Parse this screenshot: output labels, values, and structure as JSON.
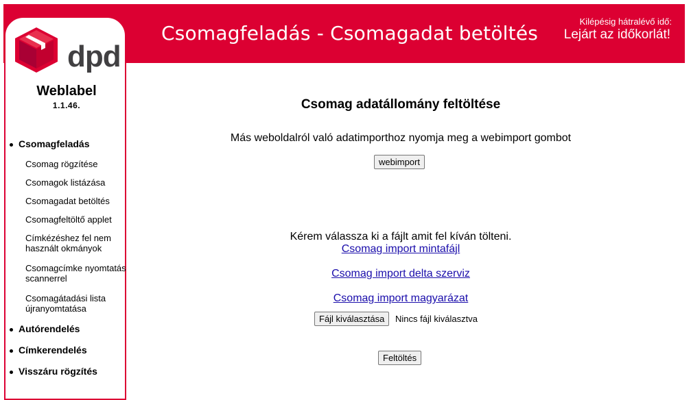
{
  "header": {
    "title": "Csomagfeladás - Csomagadat betöltés",
    "session_label": "Kilépésig hátralévő idő:",
    "session_value": "Lejárt az időkorlát!",
    "accent_color": "#dc0032"
  },
  "sidebar": {
    "logo_text": "dpd",
    "logo_icon": "dpd-cube-icon",
    "app_name": "Weblabel",
    "app_version": "1.1.46.",
    "main_items": [
      {
        "label": "Csomagfeladás"
      },
      {
        "label": "Autórendelés"
      },
      {
        "label": "Címkerendelés"
      },
      {
        "label": "Visszáru rögzítés"
      }
    ],
    "sub_items": [
      {
        "label": "Csomag rögzítése"
      },
      {
        "label": "Csomagok listázása"
      },
      {
        "label": "Csomagadat betöltés"
      },
      {
        "label": "Csomagfeltöltő applet"
      },
      {
        "label": "Címkézéshez fel nem használt okmányok"
      },
      {
        "label": "Csomagcímke nyomtatás scannerrel"
      },
      {
        "label": "Csomagátadási lista újranyomtatása"
      }
    ]
  },
  "main": {
    "heading": "Csomag adatállomány feltöltése",
    "webimport_hint": "Más weboldalról való adatimporthoz nyomja meg a webimport gombot",
    "webimport_button": "webimport",
    "choose_file_text": "Kérem válassza ki a fájlt amit fel kíván tölteni.",
    "links": [
      {
        "label": "Csomag import mintafájl"
      },
      {
        "label": "Csomag import delta szerviz"
      },
      {
        "label": "Csomag import magyarázat"
      }
    ],
    "file_button": "Fájl kiválasztása",
    "no_file_text": "Nincs fájl kiválasztva",
    "upload_button": "Feltöltés"
  }
}
